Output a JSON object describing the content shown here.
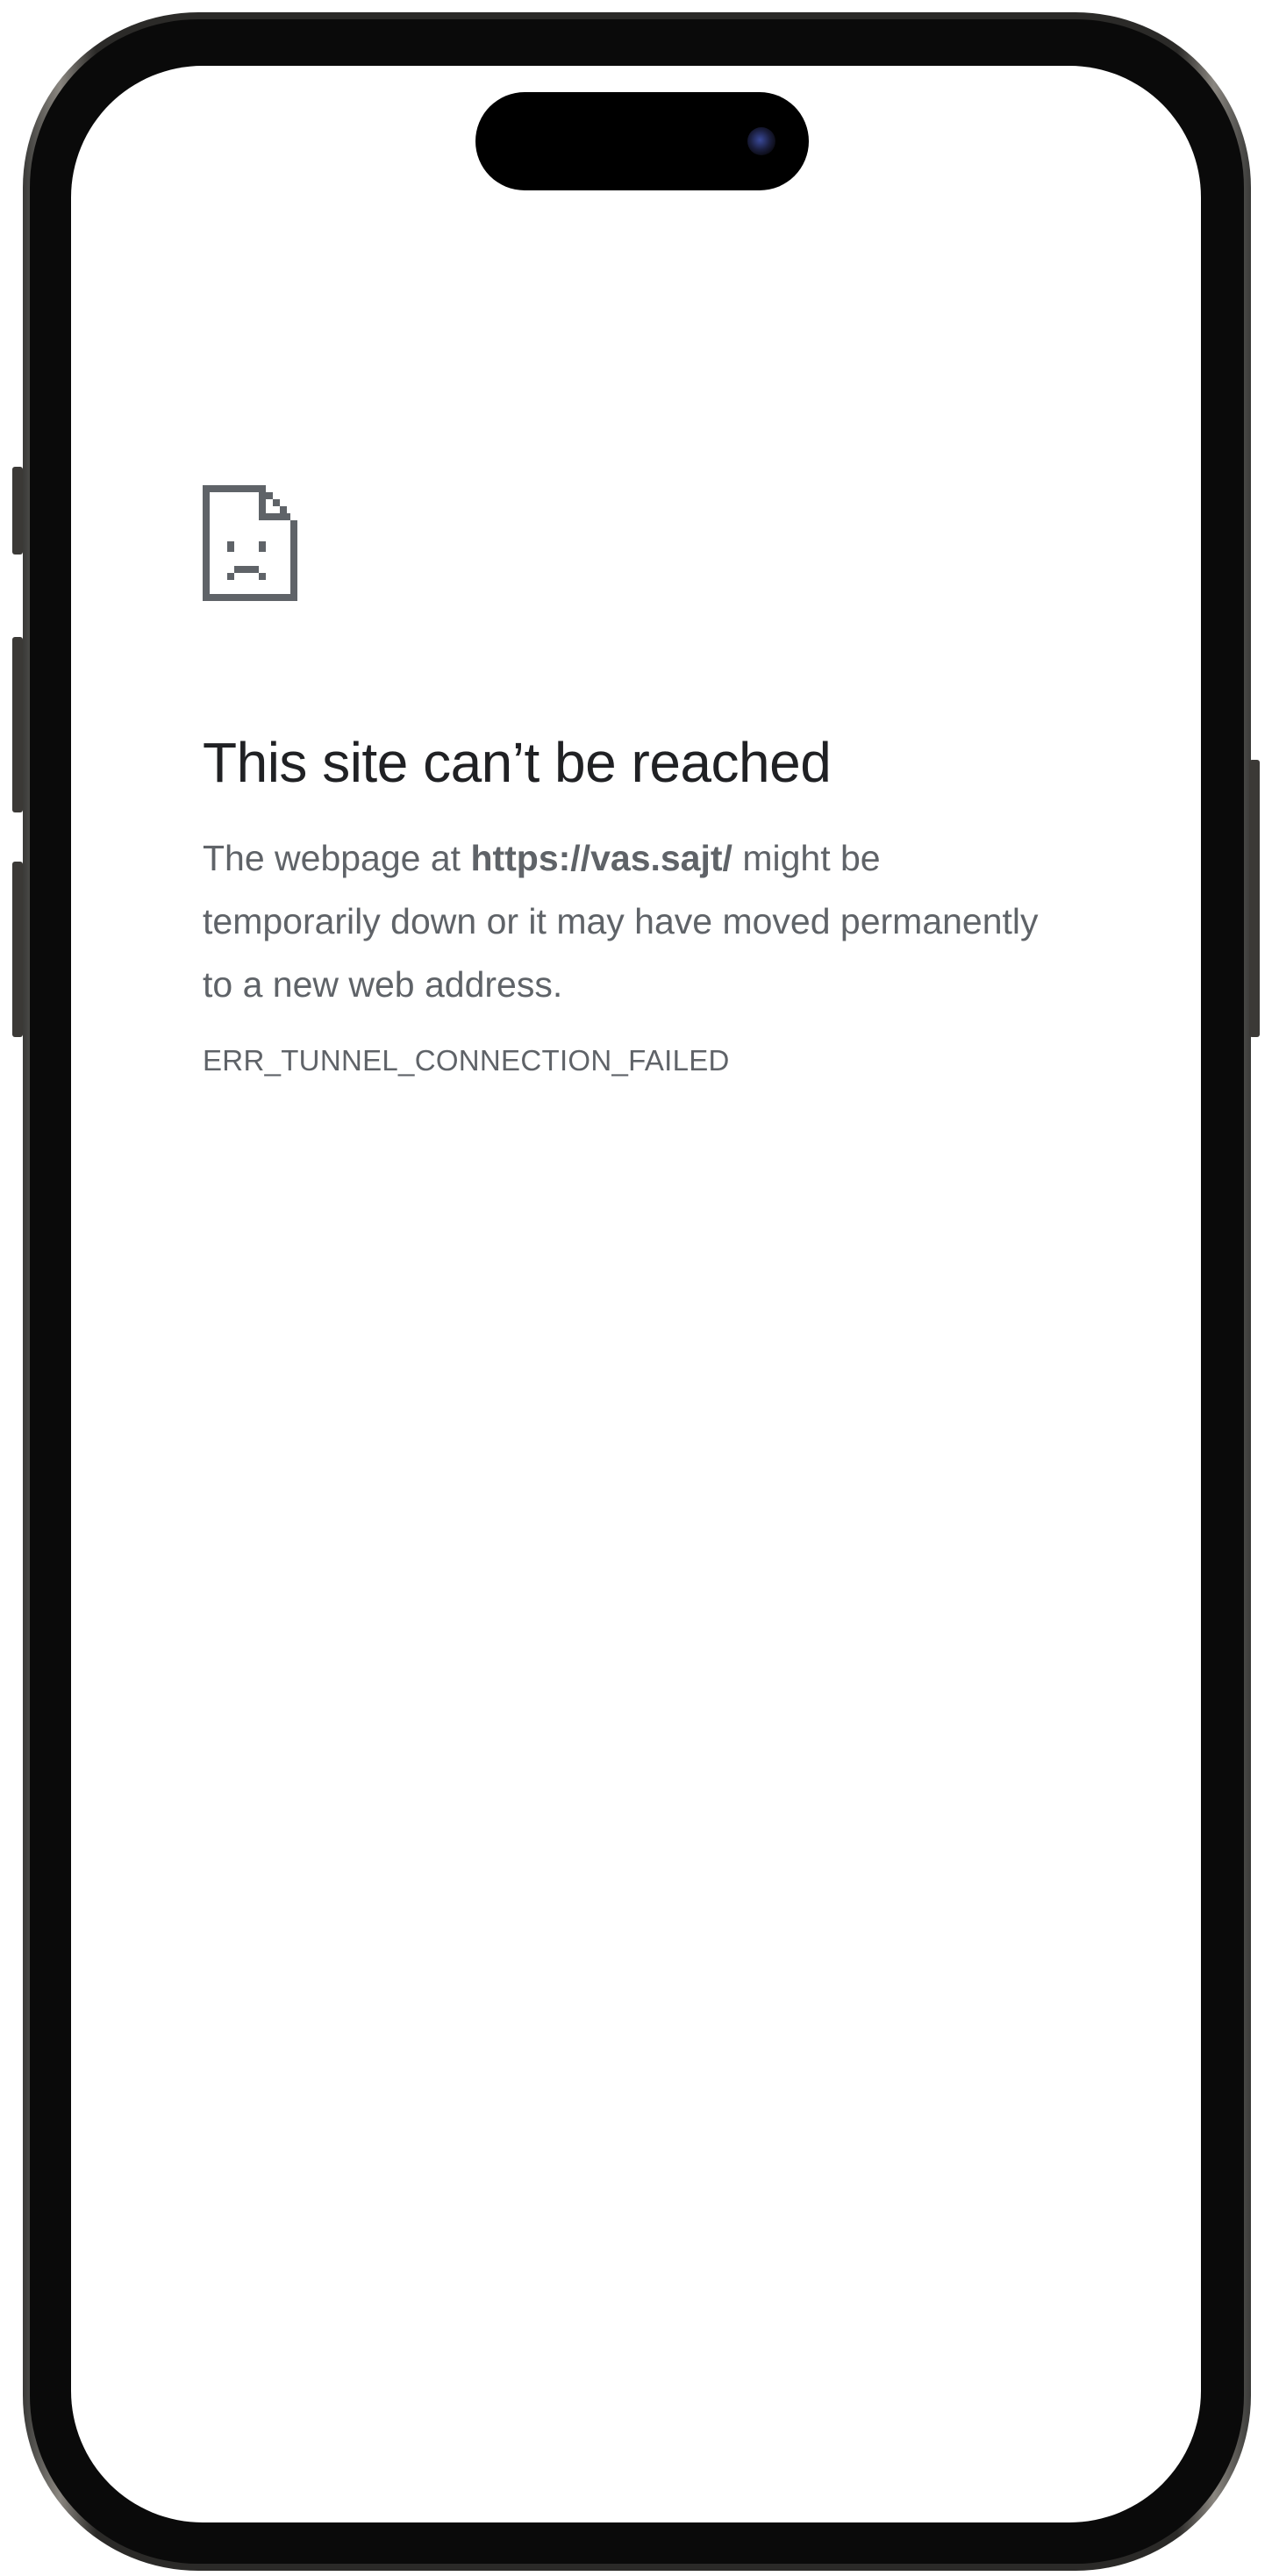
{
  "error_page": {
    "icon": "sad-page-icon",
    "title": "This site can’t be reached",
    "message_prefix": "The webpage at ",
    "url": "https://vas.sajt/",
    "message_suffix": " might be temporarily down or it may have moved permanently to a new web address.",
    "error_code": "ERR_TUNNEL_CONNECTION_FAILED"
  },
  "colors": {
    "title": "#202124",
    "body_text": "#5f6368",
    "icon": "#5f6368",
    "background": "#ffffff",
    "frame": "#2b2a28"
  }
}
